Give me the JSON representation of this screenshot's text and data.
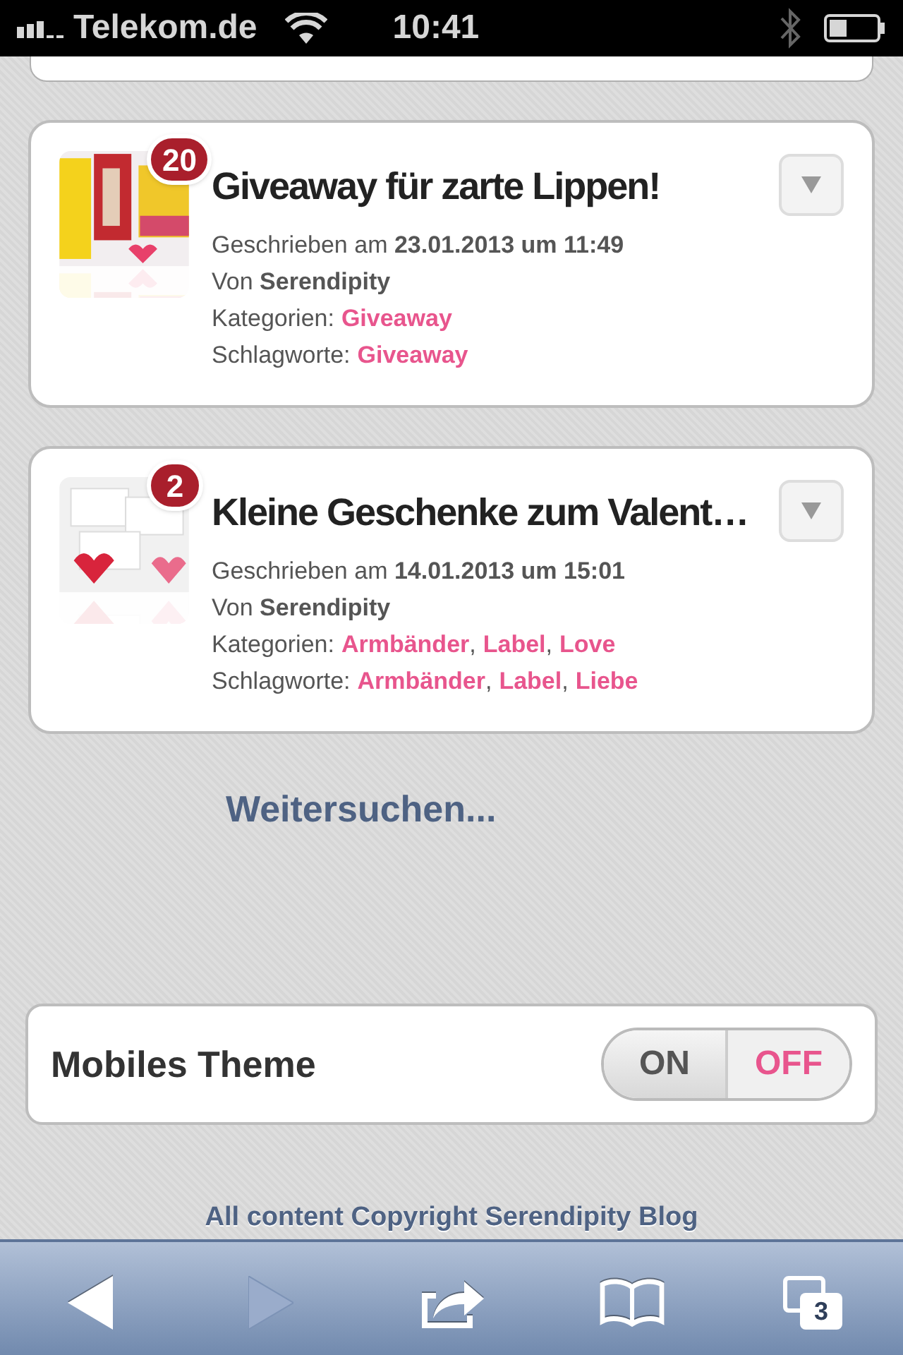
{
  "status_bar": {
    "carrier": "Telekom.de",
    "time": "10:41"
  },
  "posts": [
    {
      "count": "20",
      "title": "Giveaway für zarte Lippen!",
      "lines": [
        {
          "kind": "bold",
          "label": "Geschrieben am",
          "value": "23.01.2013 um 11:49"
        },
        {
          "kind": "bold",
          "label": "Von",
          "value": "Serendipity"
        },
        {
          "kind": "links",
          "label": "Kategorien:",
          "links": [
            "Giveaway"
          ]
        },
        {
          "kind": "links",
          "label": "Schlagworte:",
          "links": [
            "Giveaway"
          ]
        }
      ]
    },
    {
      "count": "2",
      "title": "Kleine Geschenke zum Valent…",
      "lines": [
        {
          "kind": "bold",
          "label": "Geschrieben am",
          "value": "14.01.2013 um 15:01"
        },
        {
          "kind": "bold",
          "label": "Von",
          "value": "Serendipity"
        },
        {
          "kind": "links",
          "label": "Kategorien:",
          "links": [
            "Armbänder",
            "Label",
            "Love"
          ]
        },
        {
          "kind": "links",
          "label": "Schlagworte:",
          "links": [
            "Armbänder",
            "Label",
            "Liebe"
          ]
        }
      ]
    }
  ],
  "separator": ",",
  "more_link": "Weitersuchen...",
  "theme_switch": {
    "label": "Mobiles Theme",
    "on_text": "ON",
    "off_text": "OFF",
    "on": false
  },
  "footer": "All content Copyright Serendipity Blog",
  "toolbar": [
    {
      "kind": "back",
      "disabled": false
    },
    {
      "kind": "forward",
      "disabled": true
    },
    {
      "kind": "share",
      "disabled": false
    },
    {
      "kind": "bookmarks",
      "disabled": false
    },
    {
      "kind": "tabs",
      "disabled": false,
      "count": "3"
    }
  ]
}
